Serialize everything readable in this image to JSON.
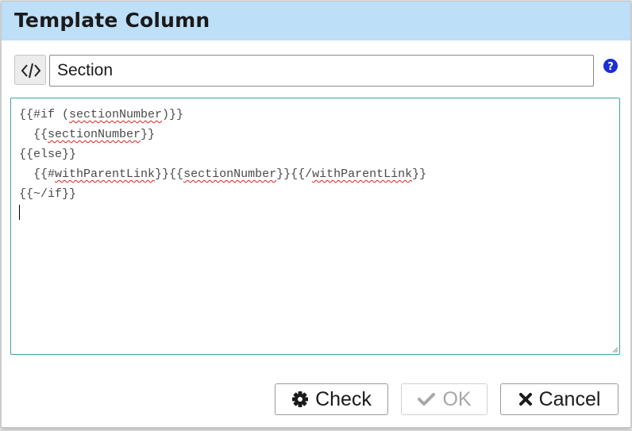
{
  "dialog": {
    "title": "Template Column"
  },
  "name_field": {
    "value": "Section",
    "code_toggle_icon": "code-icon",
    "help_icon": "question-circle-icon",
    "help_color": "#1b2fd6"
  },
  "editor": {
    "lines": [
      "{{#if (sectionNumber)}}",
      "  {{sectionNumber}}",
      "{{else}}",
      "  {{#withParentLink}}{{sectionNumber}}{{/withParentLink}}",
      "{{~/if}}"
    ],
    "spellcheck_flagged_words": [
      "sectionNumber",
      "withParentLink"
    ],
    "border_color": "#3aa3a8"
  },
  "buttons": {
    "check": {
      "label": "Check",
      "icon": "gear-icon",
      "enabled": true
    },
    "ok": {
      "label": "OK",
      "icon": "checkmark-icon",
      "enabled": false
    },
    "cancel": {
      "label": "Cancel",
      "icon": "close-icon",
      "enabled": true
    }
  },
  "colors": {
    "titlebar": "#bddff8"
  }
}
